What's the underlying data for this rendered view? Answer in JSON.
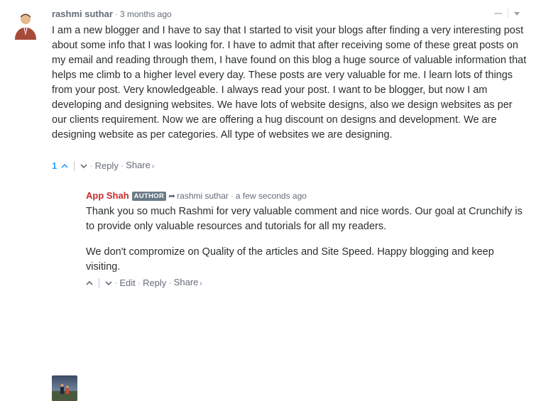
{
  "comments": [
    {
      "author": "rashmi suthar",
      "time": "3 months ago",
      "paragraphs": [
        "I am a new blogger and I have to say that I started to visit your blogs after finding a very interesting post about some info that I was looking for. I have to admit that after receiving some of these great posts on my email and reading through them, I have found on this blog a huge source of valuable information that helps me climb to a higher level every day. These posts are very valuable for me. I learn lots of things from your post. Very knowledgeable. I always read your post. I want to be blogger, but now I am developing and designing websites. We have lots of website designs, also we design websites as per our clients requirement. Now we are offering a hug discount on designs and development. We are designing website as per categories. All type of websites we are designing."
      ],
      "votes": "1",
      "actions": {
        "reply": "Reply",
        "share": "Share"
      }
    },
    {
      "author": "App Shah",
      "badge": "AUTHOR",
      "in_reply_to": "rashmi suthar",
      "time": "a few seconds ago",
      "paragraphs": [
        "Thank you so much Rashmi for very valuable comment and nice words. Our goal at Crunchify is to provide only valuable resources and tutorials for all my readers.",
        "We don't compromize on Quality of the articles and Site Speed. Happy blogging and keep visiting."
      ],
      "actions": {
        "edit": "Edit",
        "reply": "Reply",
        "share": "Share"
      }
    }
  ],
  "separators": {
    "dot": "·",
    "chevron": "›"
  },
  "colors": {
    "vote_accent": "#2e9fff",
    "author_accent": "#c82b2b",
    "badge_bg": "#687a86",
    "muted": "#656c7a"
  }
}
